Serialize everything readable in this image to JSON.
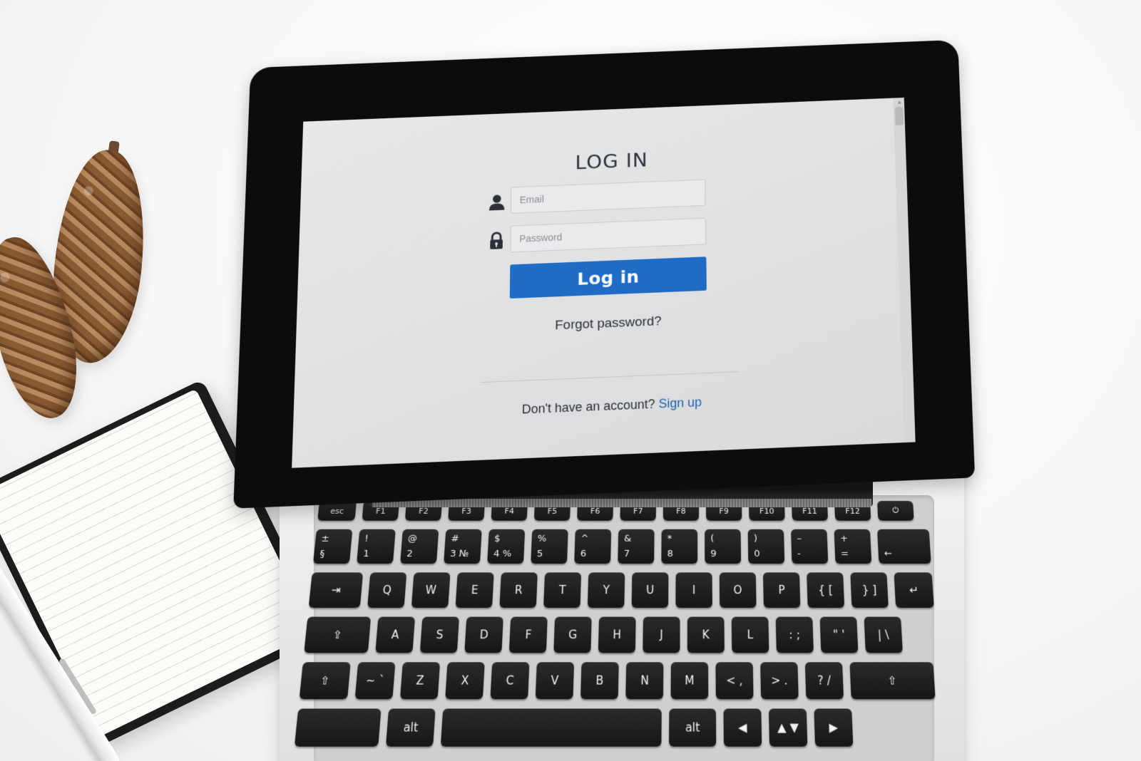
{
  "login": {
    "title": "LOG IN",
    "email_placeholder": "Email",
    "password_placeholder": "Password",
    "login_button": "Log in",
    "forgot_password": "Forgot password?",
    "signup_prompt": "Don't have an account?",
    "signup_link": "Sign up"
  },
  "icons": {
    "email": "user-icon",
    "password": "lock-icon"
  },
  "colors": {
    "accent": "#1f6cc6",
    "link": "#1f5fae",
    "screen_bg": "#e3e4e6"
  },
  "keyboard": {
    "fn_row": [
      "esc",
      "F1",
      "F2",
      "F3",
      "F4",
      "F5",
      "F6",
      "F7",
      "F8",
      "F9",
      "F10",
      "F11",
      "F12",
      "⏻"
    ],
    "number_row": [
      {
        "top": "±",
        "bottom": "§"
      },
      {
        "top": "!",
        "bottom": "1"
      },
      {
        "top": "@",
        "bottom": "2"
      },
      {
        "top": "#",
        "bottom": "3 №"
      },
      {
        "top": "$",
        "bottom": "4 %"
      },
      {
        "top": "%",
        "bottom": "5"
      },
      {
        "top": "^",
        "bottom": "6"
      },
      {
        "top": "&",
        "bottom": "7"
      },
      {
        "top": "*",
        "bottom": "8"
      },
      {
        "top": "(",
        "bottom": "9"
      },
      {
        "top": ")",
        "bottom": "0"
      },
      {
        "top": "–",
        "bottom": "-"
      },
      {
        "top": "+",
        "bottom": "="
      },
      {
        "top": "",
        "bottom": "←"
      }
    ],
    "q_row": [
      "⇥",
      "Q",
      "W",
      "E",
      "R",
      "T",
      "Y",
      "U",
      "I",
      "O",
      "P",
      "{ [",
      "} ]",
      "↵"
    ],
    "a_row": [
      "⇪",
      "A",
      "S",
      "D",
      "F",
      "G",
      "H",
      "J",
      "K",
      "L",
      ": ;",
      "\" '",
      "| \\"
    ],
    "z_row": [
      "⇧",
      "~ `",
      "Z",
      "X",
      "C",
      "V",
      "B",
      "N",
      "M",
      "< ,",
      "> .",
      "? /",
      "⇧"
    ],
    "bottom_row": [
      "",
      "alt",
      "",
      "alt",
      "◀",
      "▲ ▼",
      "▶"
    ]
  }
}
